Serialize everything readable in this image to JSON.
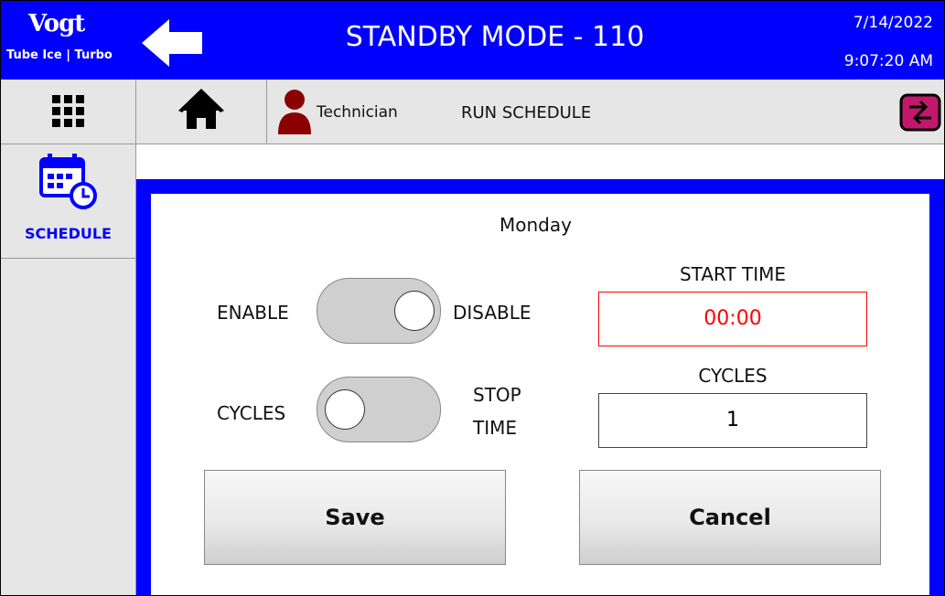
{
  "header": {
    "logo_brand": "Vogt",
    "logo_tagline": "Tube Ice | Turbo",
    "title": "STANDBY MODE - 110",
    "date": "7/14/2022",
    "time": "9:07:20 AM",
    "background_color": "#0000ff"
  },
  "toolbar": {
    "user_role": "Technician",
    "page_name": "RUN SCHEDULE",
    "icons": [
      "grid-menu-icon",
      "home-icon",
      "user-icon",
      "switch-arrows-icon"
    ]
  },
  "sidebar": {
    "items": [
      {
        "label": "SCHEDULE",
        "icon": "calendar-clock-icon",
        "active": true
      }
    ]
  },
  "schedule": {
    "day": "Monday",
    "enable_toggle": {
      "left_label": "ENABLE",
      "right_label": "DISABLE",
      "state": "DISABLE"
    },
    "mode_toggle": {
      "left_label": "CYCLES",
      "right_label_line1": "STOP",
      "right_label_line2": "TIME",
      "state": "CYCLES"
    },
    "start_time": {
      "label": "START TIME",
      "value": "00:00",
      "value_color": "#ff0000",
      "border_color": "#ff0000"
    },
    "cycles": {
      "label": "CYCLES",
      "value": "1"
    },
    "save_label": "Save",
    "cancel_label": "Cancel"
  }
}
